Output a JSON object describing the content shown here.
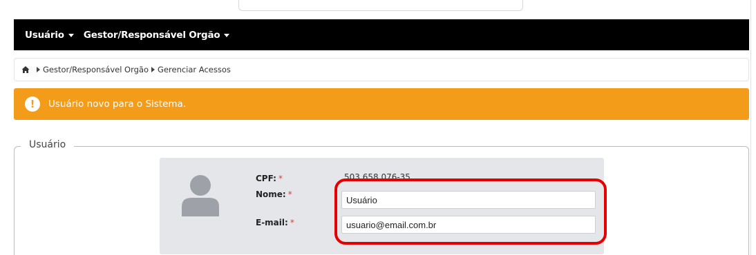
{
  "navbar": {
    "items": [
      {
        "label": "Usuário"
      },
      {
        "label": "Gestor/Responsável Orgão"
      }
    ]
  },
  "breadcrumb": {
    "icon": "home-icon",
    "items": [
      "Gestor/Responsável Orgão",
      "Gerenciar Acessos"
    ]
  },
  "alert": {
    "icon": "exclamation-icon",
    "message": "Usuário novo para o Sistema.",
    "color": "#f39c1a"
  },
  "user_section": {
    "legend": "Usuário",
    "cpf_label": "CPF:",
    "cpf_value": "503.658.076-35",
    "name_label": "Nome:",
    "name_value": "Usuário",
    "email_label": "E-mail:",
    "email_value": "usuario@email.com.br",
    "required_marker": "*"
  },
  "colors": {
    "navbar_bg": "#000000",
    "alert_bg": "#f39c1a",
    "highlight": "#e60000",
    "card_bg": "#e4e6ea"
  }
}
